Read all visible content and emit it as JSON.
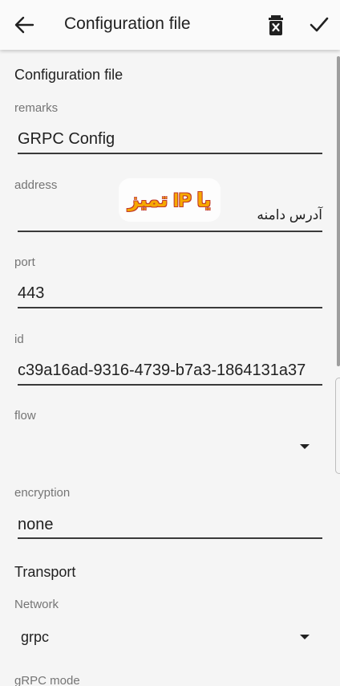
{
  "appbar": {
    "title": "Configuration file",
    "back_icon": "arrow-left-icon",
    "delete_icon": "delete-box-icon",
    "save_icon": "check-icon"
  },
  "form": {
    "section_title": "Configuration file",
    "remarks": {
      "label": "remarks",
      "value": "GRPC Config"
    },
    "address": {
      "label": "address",
      "value": "آدرس دامنه"
    },
    "port": {
      "label": "port",
      "value": "443"
    },
    "id": {
      "label": "id",
      "value": "c39a16ad-9316-4739-b7a3-1864131a37"
    },
    "flow": {
      "label": "flow",
      "value": ""
    },
    "encryption": {
      "label": "encryption",
      "value": "none"
    },
    "transport_title": "Transport",
    "network": {
      "label": "Network",
      "value": "grpc"
    },
    "grpc_mode": {
      "label": "gRPC mode"
    }
  },
  "overlay": {
    "watermark_text": "یا IP تمیز"
  }
}
